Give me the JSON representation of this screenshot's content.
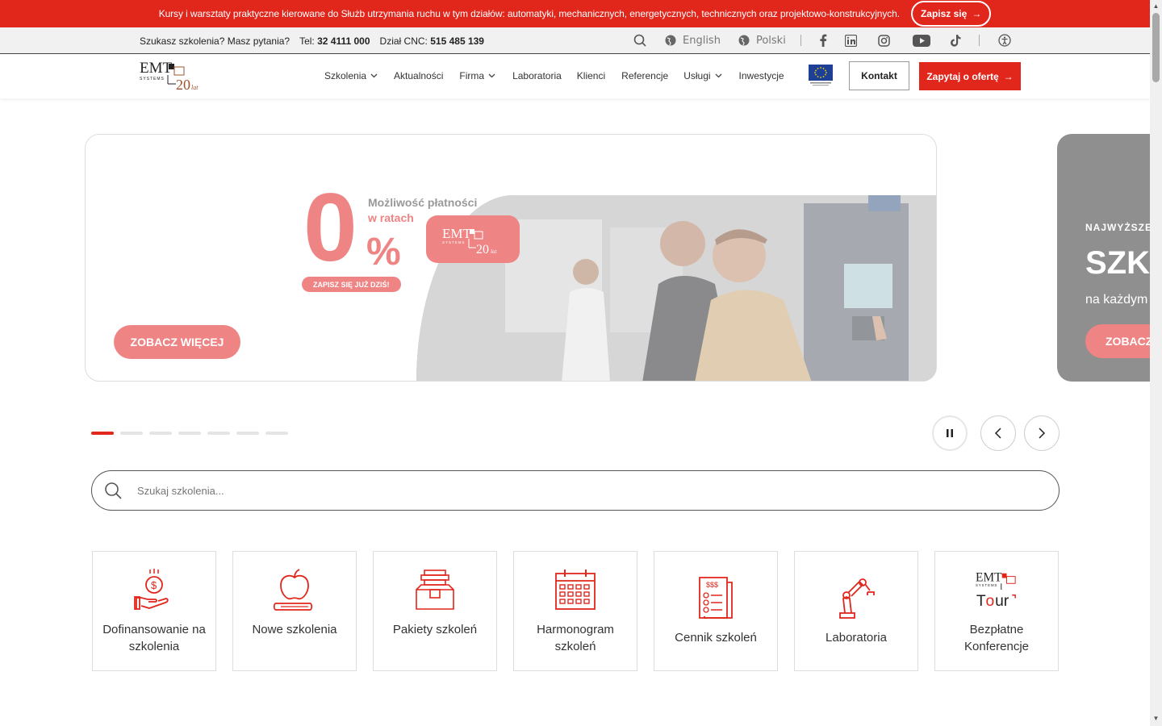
{
  "promo": {
    "text": "Kursy i warsztaty praktyczne kierowane do Służb utrzymania ruchu w tym działów: automatyki, mechanicznych, energetycznych, technicznych oraz projektowo-konstrukcyjnych.",
    "button": "Zapisz się"
  },
  "infobar": {
    "question": "Szukasz szkolenia? Masz pytania?",
    "tel_label": "Tel:",
    "tel": "32 4111 000",
    "cnc_label": "Dział CNC:",
    "cnc": "515 485 139",
    "lang_en": "English",
    "lang_pl": "Polski"
  },
  "nav": {
    "items": [
      "Szkolenia",
      "Aktualności",
      "Firma",
      "Laboratoria",
      "Klienci",
      "Referencje",
      "Usługi",
      "Inwestycje"
    ],
    "dropdown_flags": [
      true,
      false,
      true,
      false,
      false,
      false,
      true,
      false
    ],
    "contact": "Kontakt",
    "offer": "Zapytaj o ofertę"
  },
  "slide1": {
    "zero": "0",
    "pct": "%",
    "line1": "Możliwość płatności",
    "line2": "w ratach",
    "pill": "ZAPISZ SIĘ JUŻ DZIŚ!",
    "button": "ZOBACZ WIĘCEJ"
  },
  "slide2": {
    "kicker": "NAJWYŻSZE",
    "title": "SZKO",
    "subtitle": "na każdym",
    "button": "ZOBACZ"
  },
  "carousel": {
    "dots": 7,
    "active_index": 0
  },
  "search": {
    "placeholder": "Szukaj szkolenia..."
  },
  "tiles": [
    {
      "label": "Dofinansowanie na szkolenia",
      "icon": "hand-coin-icon"
    },
    {
      "label": "Nowe szkolenia",
      "icon": "apple-book-icon"
    },
    {
      "label": "Pakiety szkoleń",
      "icon": "package-icon"
    },
    {
      "label": "Harmonogram szkoleń",
      "icon": "calendar-icon"
    },
    {
      "label": "Cennik szkoleń",
      "icon": "price-list-icon"
    },
    {
      "label": "Laboratoria",
      "icon": "robot-arm-icon"
    },
    {
      "label": "Bezpłatne Konferencje",
      "icon": "emt-tour-logo"
    }
  ],
  "colors": {
    "brand_red": "#e1261c",
    "soft_red": "#ee8484"
  }
}
